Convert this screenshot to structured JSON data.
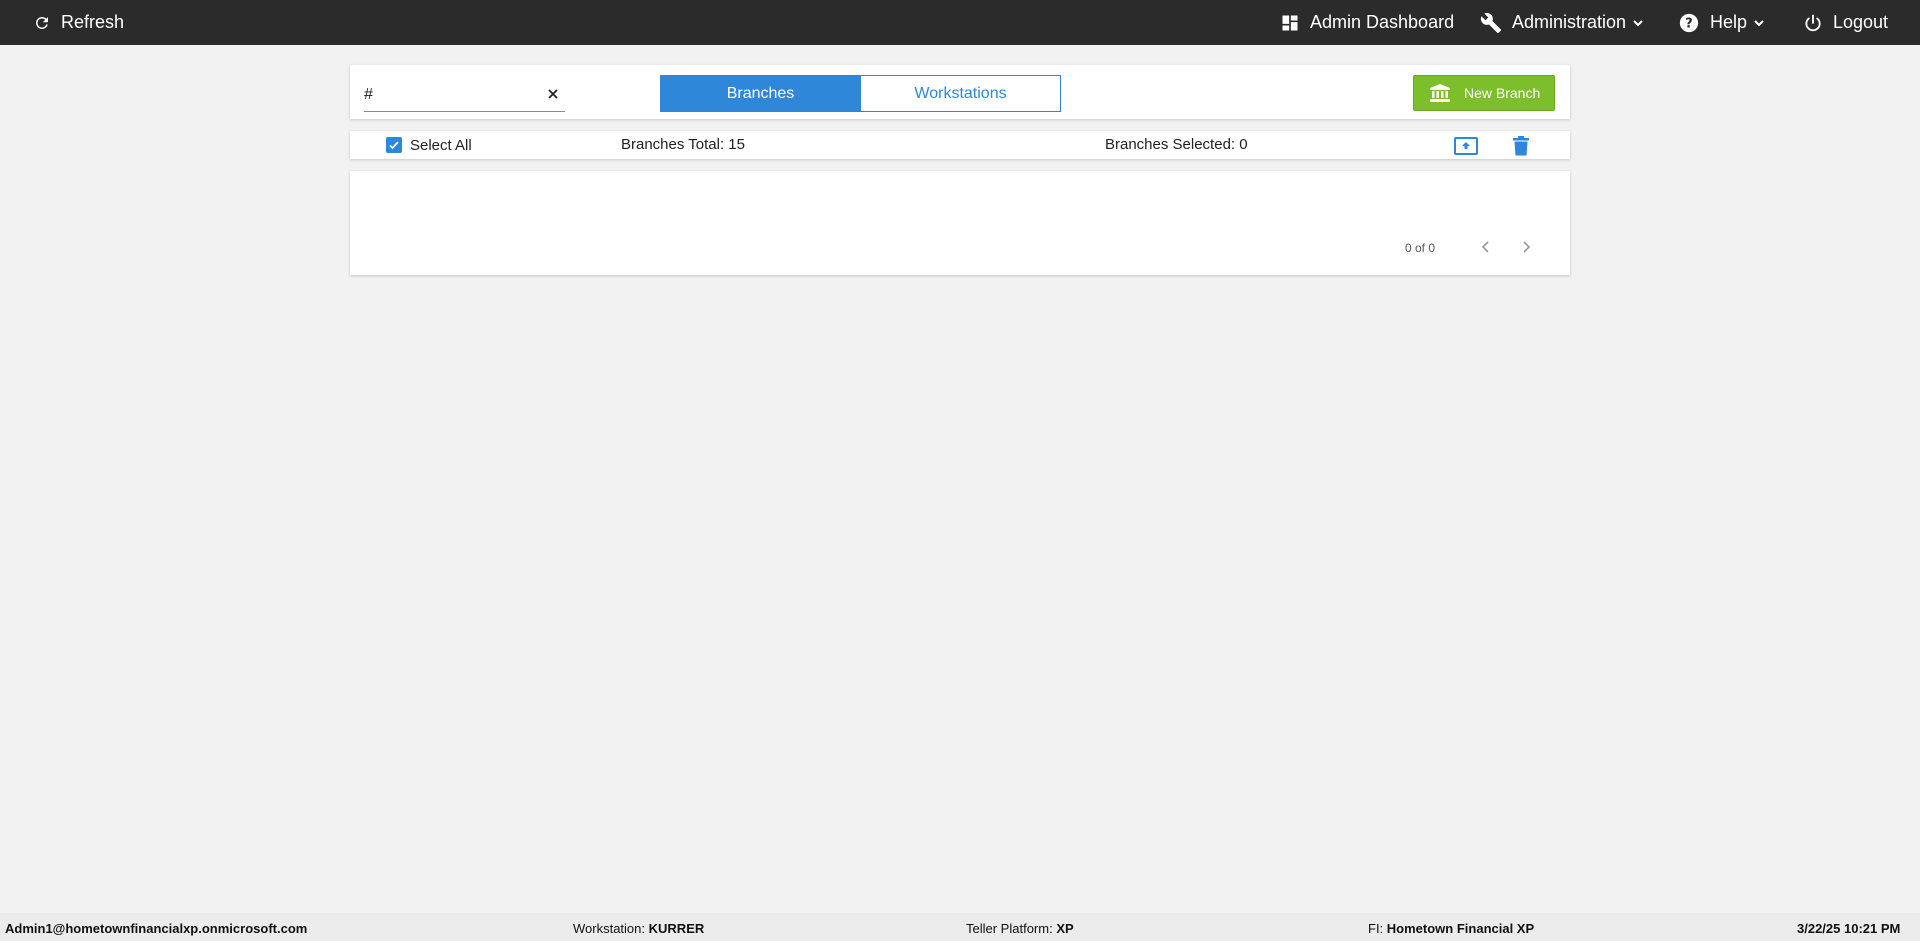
{
  "topbar": {
    "refresh_label": "Refresh",
    "admin_dashboard_label": "Admin Dashboard",
    "administration_label": "Administration",
    "help_label": "Help",
    "logout_label": "Logout"
  },
  "toolbar": {
    "search_value": "#",
    "tabs": [
      {
        "label": "Branches",
        "active": true
      },
      {
        "label": "Workstations",
        "active": false
      }
    ],
    "new_branch_label": "New Branch"
  },
  "selection": {
    "select_all_label": "Select All",
    "select_all_checked": true,
    "branches_total": "Branches Total: 15",
    "branches_selected": "Branches Selected: 0"
  },
  "pager": {
    "text": "0 of 0"
  },
  "status": {
    "user": "Admin1@hometownfinancialxp.onmicrosoft.com",
    "workstation_label": "Workstation:",
    "workstation_value": "KURRER",
    "teller_platform_label": "Teller Platform:",
    "teller_platform_value": "XP",
    "fi_label": "FI:",
    "fi_value": "Hometown Financial XP",
    "datetime": "3/22/25 10:21 PM"
  },
  "colors": {
    "topbar_bg": "#2b2b2b",
    "accent_blue": "#2e87d9",
    "new_branch_green": "#7cbf2a",
    "page_bg": "#f2f2f2"
  },
  "icons": [
    "refresh-icon",
    "dashboard-icon",
    "wrench-icon",
    "chevron-down-icon",
    "help-icon",
    "power-icon",
    "close-icon",
    "bank-icon",
    "check-icon",
    "upload-icon",
    "trash-icon",
    "chevron-left-icon",
    "chevron-right-icon"
  ]
}
